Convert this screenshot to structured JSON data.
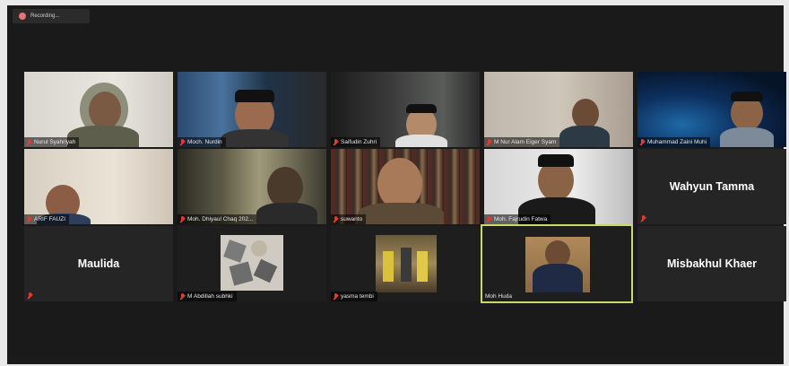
{
  "recording": {
    "label": "Recording..."
  },
  "participants": [
    {
      "name": "Nurul Syahriyah",
      "type": "video",
      "active": false
    },
    {
      "name": "Moch. Nurdin",
      "type": "video",
      "active": false
    },
    {
      "name": "Saifudin Zuhri",
      "type": "video",
      "active": false
    },
    {
      "name": "M Nur Alam Eiger Syam",
      "type": "video",
      "active": false
    },
    {
      "name": "Muhammad Zaini Muhi",
      "type": "video",
      "active": false
    },
    {
      "name": "ARIF FAUZI",
      "type": "video",
      "active": false
    },
    {
      "name": "Moh. Dhiyaul Chaq 202...",
      "type": "video",
      "active": false
    },
    {
      "name": "suwanto",
      "type": "video",
      "active": false
    },
    {
      "name": "Moh. Fajrudin Fatwa",
      "type": "video",
      "active": false
    },
    {
      "name": "Wahyun Tamma",
      "type": "name",
      "active": false
    },
    {
      "name": "Maulida",
      "type": "name",
      "active": false
    },
    {
      "name": "M Abdillah subhki",
      "type": "video",
      "active": false
    },
    {
      "name": "yasma tembi",
      "type": "video",
      "active": false
    },
    {
      "name": "Moh Huda",
      "type": "video",
      "active": true
    },
    {
      "name": "Misbakhul Khaer",
      "type": "name",
      "active": false
    }
  ]
}
